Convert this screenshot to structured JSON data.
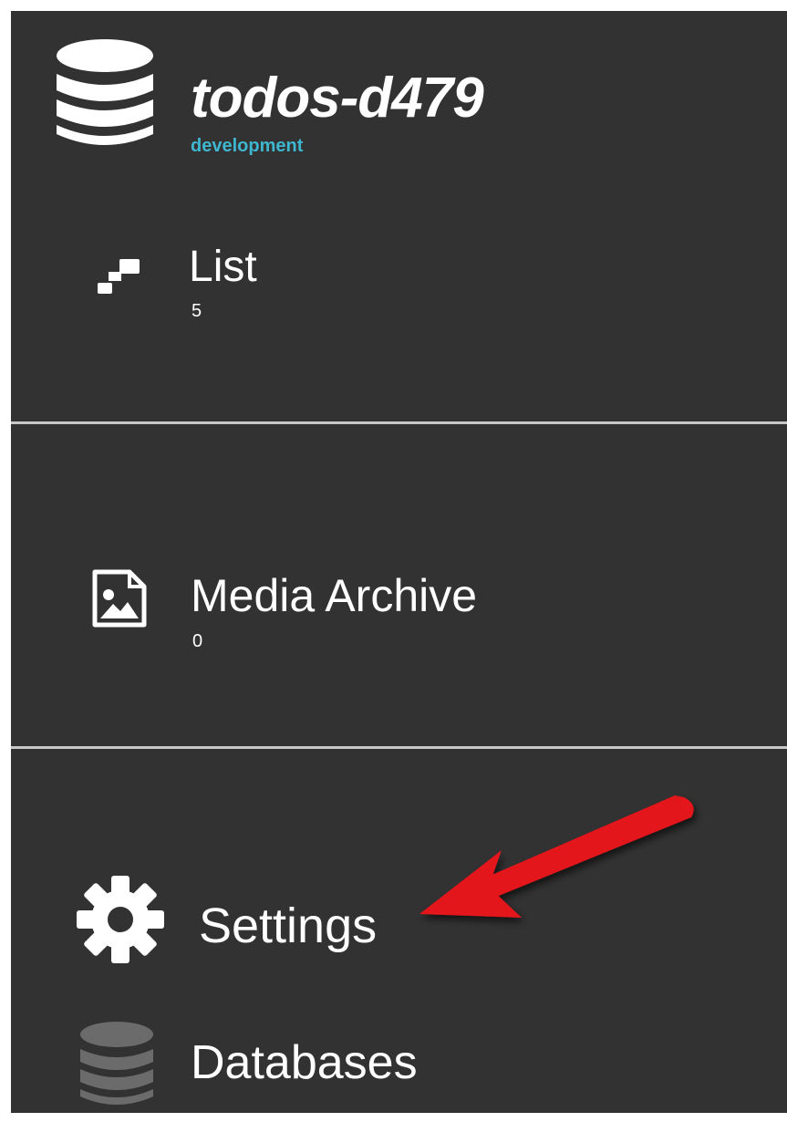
{
  "app": {
    "title": "todos-d479",
    "environment": "development",
    "logo_icon": "database-icon"
  },
  "nav": {
    "list": {
      "label": "List",
      "count": "5",
      "icon": "list-icon"
    },
    "media_archive": {
      "label": "Media Archive",
      "count": "0",
      "icon": "image-file-icon"
    },
    "settings": {
      "label": "Settings",
      "icon": "gear-icon"
    },
    "databases": {
      "label": "Databases",
      "icon": "database-icon"
    }
  },
  "annotation": {
    "arrow_icon": "red-arrow-icon",
    "arrow_color": "#e3141b"
  },
  "colors": {
    "sidebar_bg": "#323232",
    "text": "#ffffff",
    "environment": "#3fb6cf",
    "divider": "#c8c8c8",
    "databases_icon": "#6b6b6b"
  }
}
